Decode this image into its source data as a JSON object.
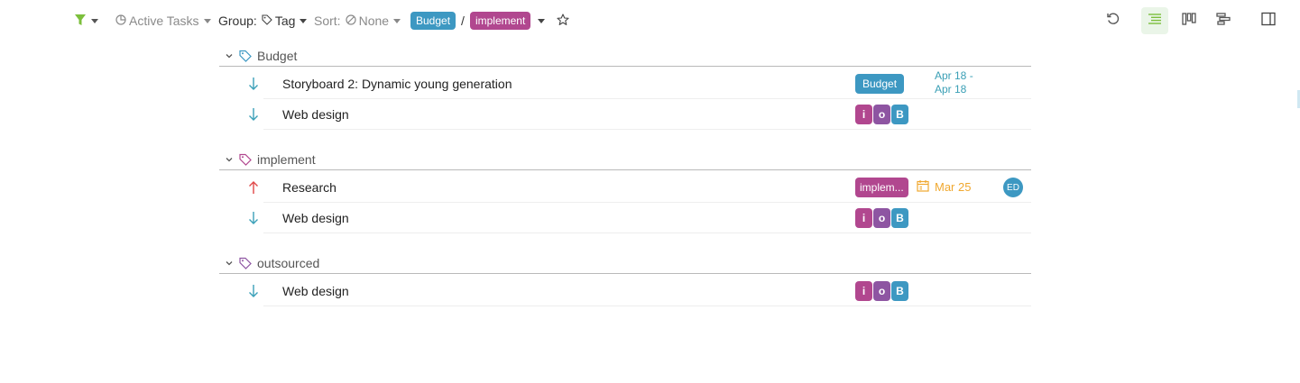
{
  "toolbar": {
    "filter_icon": "filter-icon",
    "active_tasks_label": "Active Tasks",
    "group_prefix": "Group:",
    "group_value": "Tag",
    "sort_prefix": "Sort:",
    "sort_value": "None",
    "breadcrumb": [
      "Budget",
      "implement"
    ],
    "breadcrumb_sep": "/",
    "right_icons": [
      "undo-icon",
      "list-view-icon",
      "board-view-icon",
      "gantt-view-icon",
      "sidebar-panel-icon"
    ],
    "active_view": "list-view-icon",
    "accent_color": "#7cbf3c"
  },
  "groups": [
    {
      "name": "Budget",
      "tasks": [
        {
          "title": "Storyboard 2: Dynamic young generation",
          "priority": "low",
          "labels": [
            "Budget"
          ],
          "date_range": [
            "Apr 18 -",
            "Apr 18"
          ]
        },
        {
          "title": "Web design",
          "priority": "low",
          "labels": [
            "i",
            "o",
            "B"
          ]
        }
      ]
    },
    {
      "name": "implement",
      "tasks": [
        {
          "title": "Research",
          "priority": "high",
          "labels": [
            "implem..."
          ],
          "due": "Mar 25",
          "assignee": "ED"
        },
        {
          "title": "Web design",
          "priority": "low",
          "labels": [
            "i",
            "o",
            "B"
          ]
        }
      ]
    },
    {
      "name": "outsourced",
      "tasks": [
        {
          "title": "Web design",
          "priority": "low",
          "labels": [
            "i",
            "o",
            "B"
          ]
        }
      ]
    }
  ],
  "colors": {
    "tag_blue": "#3d98c2",
    "tag_purple": "#b1478f",
    "tag_violet": "#8e55a2",
    "priority_low": "#3aa0b8",
    "priority_high": "#e04848",
    "due_orange": "#f0a830"
  }
}
